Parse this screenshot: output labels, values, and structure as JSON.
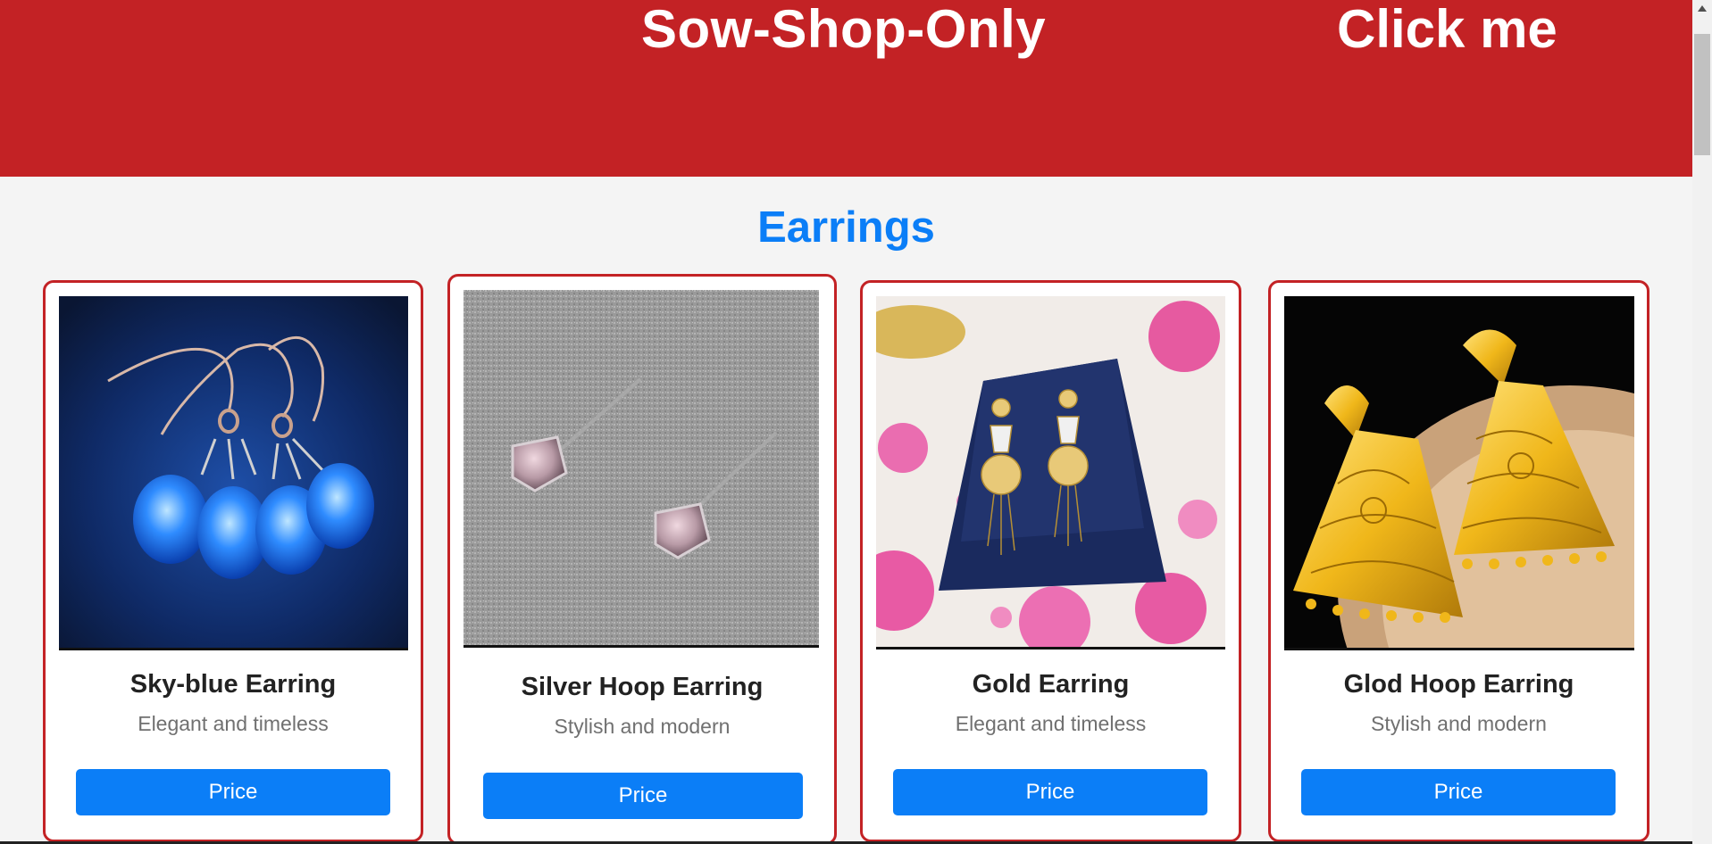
{
  "header": {
    "title": "Sow-Shop-Only",
    "cta_label": "Click me",
    "color": "#c32225"
  },
  "section": {
    "title": "Earrings",
    "color": "#0b7ef7"
  },
  "products": [
    {
      "name": "Sky-blue Earring",
      "description": "Elegant and timeless",
      "button_label": "Price",
      "image": "blue-drop-earrings-image"
    },
    {
      "name": "Silver Hoop Earring",
      "description": "Stylish and modern",
      "button_label": "Price",
      "image": "silver-stud-earrings-image"
    },
    {
      "name": "Gold Earring",
      "description": "Elegant and timeless",
      "button_label": "Price",
      "image": "gold-drop-earrings-on-stand-image"
    },
    {
      "name": "Glod Hoop Earring",
      "description": "Stylish and modern",
      "button_label": "Price",
      "image": "gold-filigree-earrings-image"
    }
  ],
  "button_color": "#0b7ef7"
}
